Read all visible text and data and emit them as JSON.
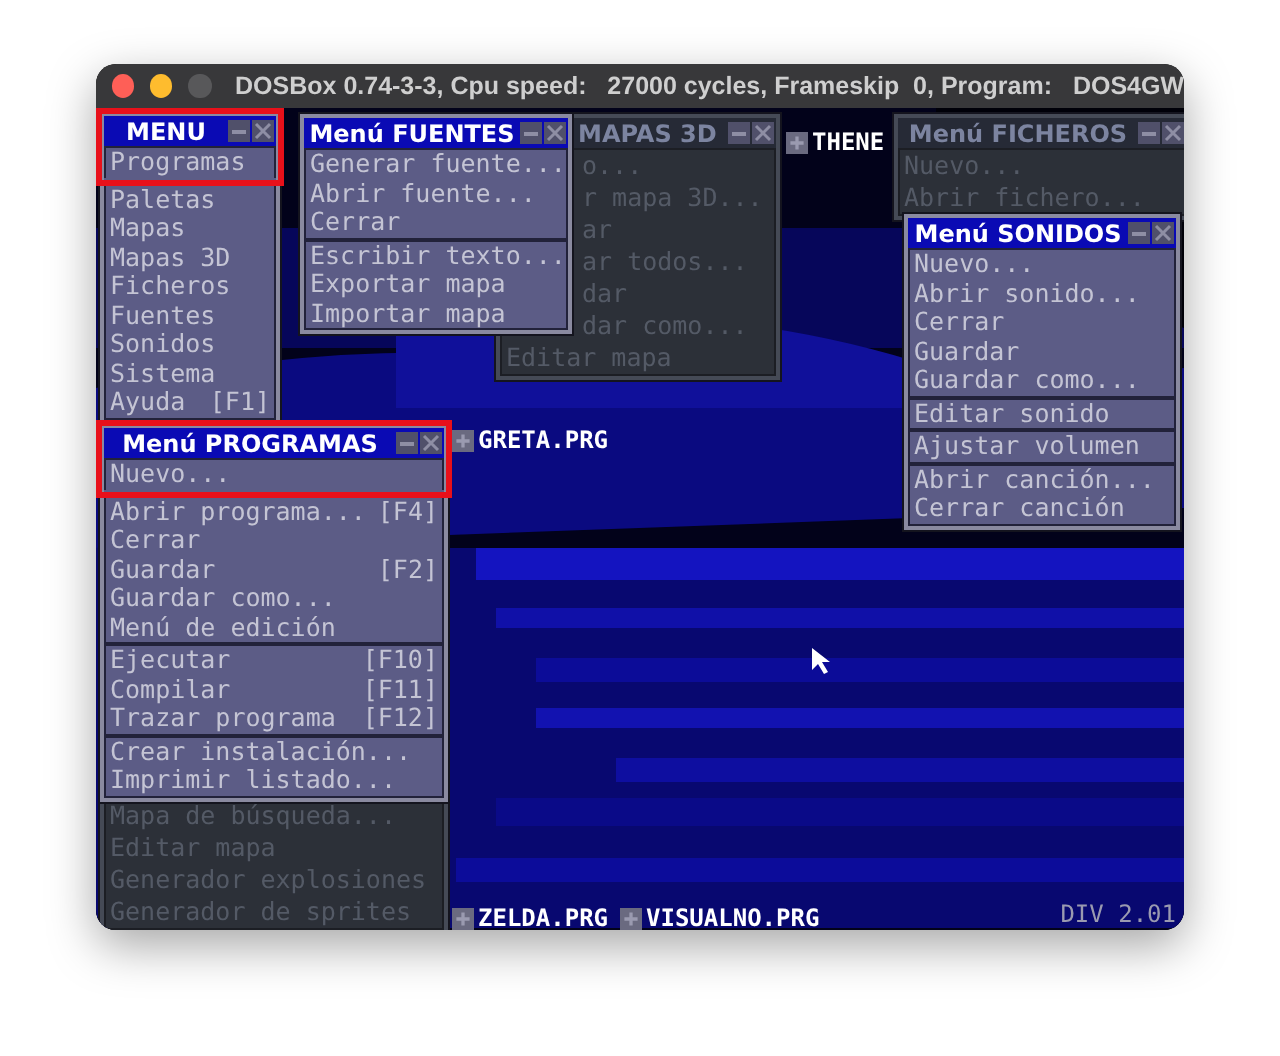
{
  "window": {
    "title": "DOSBox 0.74-3-3, Cpu speed:   27000 cycles, Frameskip  0, Program:   DOS4GW"
  },
  "desktop": {
    "icons": [
      {
        "label": "THENE"
      },
      {
        "label": "GRETA.PRG"
      },
      {
        "label": "ZELDA.PRG"
      },
      {
        "label": "VISUALNO.PRG"
      }
    ],
    "version": "DIV 2.01"
  },
  "menus": [
    {
      "title": "MENU",
      "active": true,
      "marked": true,
      "groups": [
        [
          {
            "label": "Programas"
          },
          {
            "label": "Paletas"
          },
          {
            "label": "Mapas"
          },
          {
            "label": "Mapas 3D"
          },
          {
            "label": "Ficheros"
          },
          {
            "label": "Fuentes"
          },
          {
            "label": "Sonidos"
          },
          {
            "label": "Sistema"
          },
          {
            "label": "Ayuda",
            "shortcut": "[F1]"
          }
        ]
      ]
    },
    {
      "title": "Menú FUENTES",
      "active": true,
      "marked": false,
      "groups": [
        [
          {
            "label": "Generar fuente..."
          },
          {
            "label": "Abrir fuente..."
          },
          {
            "label": "Cerrar"
          }
        ],
        [
          {
            "label": "Escribir texto..."
          },
          {
            "label": "Exportar mapa"
          },
          {
            "label": "Importar mapa"
          }
        ]
      ]
    },
    {
      "title": "MAPAS 3D",
      "active": false,
      "marked": false,
      "covered": true,
      "groups": [
        [
          {
            "label": "o...",
            "covered": true
          },
          {
            "label": "r mapa 3D...",
            "covered": true
          },
          {
            "label": "ar",
            "covered": true
          },
          {
            "label": "ar todos...",
            "covered": true
          },
          {
            "label": "dar",
            "covered": true
          },
          {
            "label": "dar como...",
            "covered": true
          },
          {
            "label": "Editar mapa",
            "covered": false
          }
        ]
      ]
    },
    {
      "title": "Menú FICHEROS",
      "active": false,
      "marked": false,
      "groups": [
        [
          {
            "label": "Nuevo..."
          },
          {
            "label": "Abrir fichero..."
          }
        ]
      ]
    },
    {
      "title": "Menú SONIDOS",
      "active": true,
      "marked": false,
      "groups": [
        [
          {
            "label": "Nuevo..."
          },
          {
            "label": "Abrir sonido..."
          },
          {
            "label": "Cerrar"
          },
          {
            "label": "Guardar"
          },
          {
            "label": "Guardar como..."
          }
        ],
        [
          {
            "label": "Editar sonido"
          }
        ],
        [
          {
            "label": "Ajustar volumen"
          }
        ],
        [
          {
            "label": "Abrir canción..."
          },
          {
            "label": "Cerrar canción"
          }
        ]
      ]
    },
    {
      "title": "Menú PROGRAMAS",
      "active": true,
      "marked": true,
      "groups": [
        [
          {
            "label": "Nuevo..."
          },
          {
            "label": "Abrir programa...",
            "shortcut": "[F4]"
          },
          {
            "label": "Cerrar"
          },
          {
            "label": "Guardar",
            "shortcut": "[F2]"
          },
          {
            "label": "Guardar como..."
          },
          {
            "label": "Menú de edición"
          }
        ],
        [
          {
            "label": "Ejecutar",
            "shortcut": "[F10]"
          },
          {
            "label": "Compilar",
            "shortcut": "[F11]"
          },
          {
            "label": "Trazar programa",
            "shortcut": "[F12]"
          }
        ],
        [
          {
            "label": "Crear instalación..."
          },
          {
            "label": "Imprimir listado..."
          }
        ]
      ]
    },
    {
      "active": false,
      "marked": false,
      "groups": [
        [
          {
            "label": "Mapa de búsqueda..."
          },
          {
            "label": "Editar mapa"
          },
          {
            "label": "Generador explosiones"
          },
          {
            "label": "Generador de sprites"
          }
        ]
      ]
    }
  ]
}
